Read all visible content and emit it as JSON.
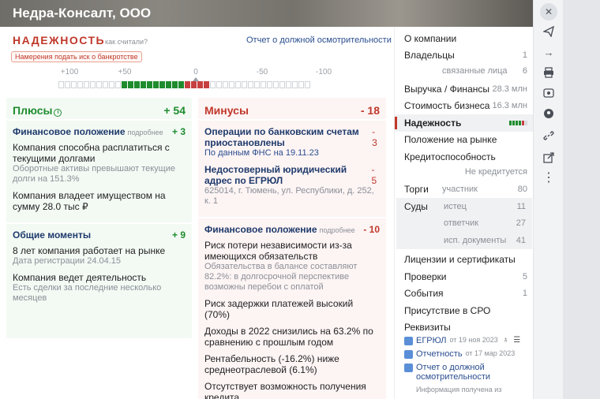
{
  "company": {
    "name": "Недра-Консалт, ООО"
  },
  "reliability": {
    "title": "НАДЕЖНОСТЬ",
    "how_link": "как считали?",
    "report_link": "Отчет о должной осмотрительности",
    "bankruptcy_badge": "Намерения подать иск о банкротстве",
    "scale_labels": [
      "+100",
      "+50",
      "0",
      "-50",
      "-100"
    ],
    "score_plus": 54,
    "score_minus": 18
  },
  "plus": {
    "title": "Плюсы",
    "score": "+ 54",
    "sections": [
      {
        "title": "Финансовое положение",
        "more": "подробнее",
        "score": "+ 3",
        "items": [
          {
            "text": "Компания способна расплатиться с текущими долгами",
            "sub": "Оборотные активы превышают текущие долги на 151.3%"
          },
          {
            "text": "Компания владеет имуществом на сумму 28.0 тыс ₽",
            "sub": ""
          }
        ]
      },
      {
        "title": "Общие моменты",
        "more": "",
        "score": "+ 9",
        "items": [
          {
            "text": "8 лет компания работает на рынке",
            "sub": "Дата регистрации 24.04.15"
          },
          {
            "text": "Компания ведет деятельность",
            "sub": "Есть сделки за последние несколько месяцев"
          }
        ]
      }
    ]
  },
  "minus": {
    "title": "Минусы",
    "score": "- 18",
    "top_items": [
      {
        "title": "Операции по банковским счетам приостановлены",
        "score": "- 3",
        "sub": "По данным ФНС на 19.11.23",
        "sub_style": "link"
      },
      {
        "title": "Недостоверный юридический адрес по ЕГРЮЛ",
        "score": "- 5",
        "sub": "625014, г. Тюмень, ул. Республики, д. 252, к. 1",
        "sub_style": "gray"
      }
    ],
    "section": {
      "title": "Финансовое положение",
      "more": "подробнее",
      "score": "- 10",
      "items": [
        {
          "text": "Риск потери независимости из-за имеющихся обязательств",
          "sub": "Обязательства в балансе составляют 82.2%: в долгосрочной перспективе возможны перебои с оплатой"
        },
        {
          "text": "Риск задержки платежей высокий (70%)",
          "sub": ""
        },
        {
          "text": "Доходы в 2022 снизились на 63.2% по сравнению с прошлым годом",
          "sub": ""
        },
        {
          "text": "Рентабельность (-16.2%) ниже среднеотраслевой (6.1%)",
          "sub": ""
        },
        {
          "text": "Отсутствует возможность получения кредита",
          "sub": ""
        }
      ]
    }
  },
  "nav": {
    "about": "О компании",
    "owners": {
      "label": "Владельцы",
      "value": "1"
    },
    "related": {
      "label": "связанные лица",
      "value": "6"
    },
    "revenue": {
      "label": "Выручка / Финансы",
      "value": "28.3 млн"
    },
    "cost": {
      "label": "Стоимость бизнеса",
      "value": "16.3 млн"
    },
    "reliability": "Надежность",
    "market": "Положение на рынке",
    "credit": {
      "label": "Кредитоспособность",
      "value": "Не кредитуется"
    },
    "tenders": {
      "label": "Торги",
      "mid": "участник",
      "value": "80"
    },
    "courts": {
      "label": "Суды",
      "rows": [
        {
          "mid": "истец",
          "value": "11"
        },
        {
          "mid": "ответчик",
          "value": "27"
        },
        {
          "mid": "исп. документы",
          "value": "41"
        }
      ]
    },
    "licenses": "Лицензии и сертификаты",
    "checks": {
      "label": "Проверки",
      "value": "5"
    },
    "events": {
      "label": "События",
      "value": "1"
    },
    "sro": "Присутствие в СРО",
    "requisites": "Реквизиты"
  },
  "docs": {
    "egrul": {
      "label": "ЕГРЮЛ",
      "date": "от 19 ноя 2023"
    },
    "reports": {
      "label": "Отчетность",
      "date": "от 17 мар 2023"
    },
    "diligence": {
      "label": "Отчет о должной осмотрительности"
    },
    "note": "Информация получена из"
  },
  "colors": {
    "accent_red": "#c0392b",
    "accent_green": "#1e8c2e",
    "link_blue": "#2a4d8f"
  },
  "icons": [
    "close-icon",
    "send-icon",
    "arrow-right-icon",
    "print-icon",
    "eye-icon",
    "bookmark-icon",
    "link-icon",
    "export-icon",
    "more-icon"
  ]
}
